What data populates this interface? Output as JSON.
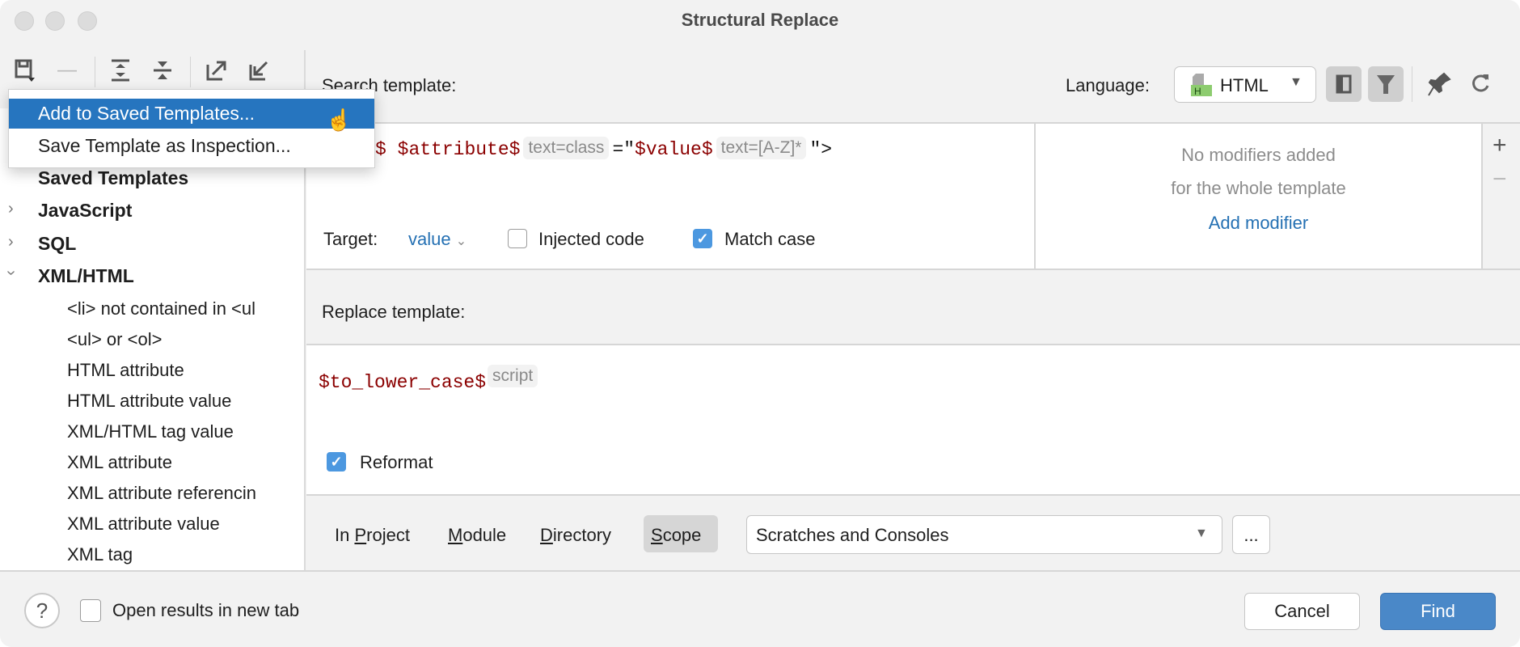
{
  "window": {
    "title": "Structural Replace"
  },
  "toolbar": {
    "icons": [
      "save-dropdown-icon",
      "remove-icon",
      "expand-all-icon",
      "collapse-all-icon",
      "export-icon",
      "import-icon"
    ]
  },
  "popup_menu": {
    "items": [
      {
        "label": "Add to Saved Templates...",
        "selected": true
      },
      {
        "label": "Save Template as Inspection..."
      }
    ]
  },
  "tree": {
    "saved_templates": "Saved Templates",
    "groups": [
      {
        "label": "JavaScript",
        "expanded": false
      },
      {
        "label": "SQL",
        "expanded": false
      },
      {
        "label": "XML/HTML",
        "expanded": true
      }
    ],
    "children": [
      "<li> not contained in <ul",
      "<ul> or <ol>",
      "HTML attribute",
      "HTML attribute value",
      "XML/HTML tag value",
      "XML attribute",
      "XML attribute referencin",
      "XML attribute value",
      "XML tag"
    ]
  },
  "search": {
    "label": "Search template:",
    "language_label": "Language:",
    "language": "HTML",
    "code": {
      "tag": "<$tag$",
      "attribute": "$attribute$",
      "attribute_filter": "text=class",
      "equals": "=\"",
      "value": "$value$",
      "value_filter": "text=[A-Z]*",
      "close": "\">"
    },
    "target_label": "Target:",
    "target_value": "value",
    "injected_code": {
      "label": "Injected code",
      "checked": false
    },
    "match_case": {
      "label": "Match case",
      "checked": true
    }
  },
  "modifiers": {
    "line1": "No modifiers added",
    "line2": "for the whole template",
    "add_link": "Add modifier"
  },
  "replace": {
    "label": "Replace template:",
    "code": "$to_lower_case$",
    "filter": "script",
    "reformat": {
      "label": "Reformat",
      "checked": true
    }
  },
  "scope": {
    "tabs": [
      {
        "pre": "In ",
        "u": "P",
        "post": "roject"
      },
      {
        "pre": "",
        "u": "M",
        "post": "odule"
      },
      {
        "pre": "",
        "u": "D",
        "post": "irectory"
      },
      {
        "pre": "",
        "u": "S",
        "post": "cope",
        "selected": true
      }
    ],
    "selected_scope": "Scratches and Consoles",
    "more_button": "..."
  },
  "footer": {
    "help": "?",
    "open_new_tab": {
      "label": "Open results in new tab",
      "checked": false
    },
    "cancel": "Cancel",
    "find": "Find"
  },
  "colors": {
    "accent": "#2675bf",
    "find_button": "#4a88c8",
    "code_var": "#8b0000",
    "link": "#2470b3"
  }
}
